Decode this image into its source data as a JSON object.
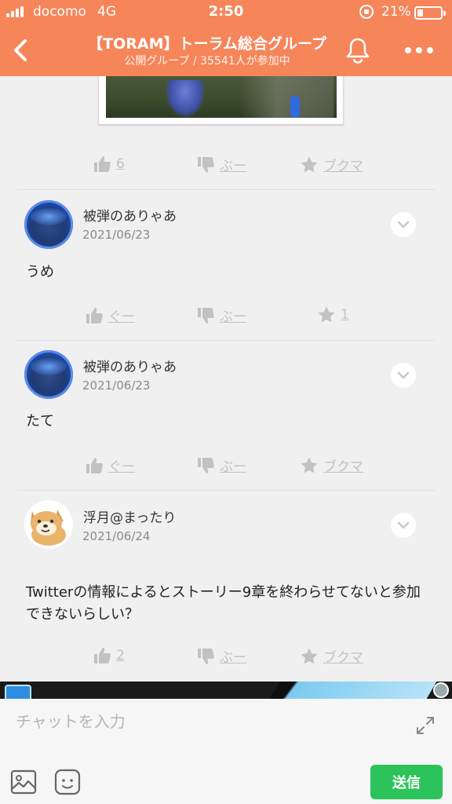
{
  "status_bar": {
    "carrier": "docomo",
    "network": "4G",
    "time": "2:50",
    "battery": "21%"
  },
  "header": {
    "title": "【TORAM】トーラム総合グループ",
    "subtitle": "公開グループ / 35541人が参加中"
  },
  "posts": [
    {
      "actions": {
        "like": "6",
        "boo": "ぶー",
        "bookmark": "ブクマ"
      }
    },
    {
      "user": "被弾のありゃあ",
      "date": "2021/06/23",
      "text": "うめ",
      "actions": {
        "like": "ぐー",
        "boo": "ぶー",
        "bookmark": "1"
      }
    },
    {
      "user": "被弾のありゃあ",
      "date": "2021/06/23",
      "text": "たて",
      "actions": {
        "like": "ぐー",
        "boo": "ぶー",
        "bookmark": "ブクマ"
      }
    },
    {
      "user": "浮月@まったり",
      "date": "2021/06/24",
      "text": "Twitterの情報によるとストーリー9章を終わらせてないと参加できないらしい？",
      "actions": {
        "like": "2",
        "boo": "ぶー",
        "bookmark": "ブクマ"
      }
    }
  ],
  "composer": {
    "placeholder": "チャットを入力",
    "send_label": "送信"
  },
  "colors": {
    "header": "#f6855a",
    "send": "#2cc45a",
    "inactive_action": "#c2c2c2"
  },
  "icons": [
    "back-icon",
    "bell-icon",
    "more-icon",
    "thumbs-up-icon",
    "thumbs-down-icon",
    "star-icon",
    "chevron-down-icon",
    "expand-icon",
    "image-icon",
    "emoji-icon"
  ]
}
